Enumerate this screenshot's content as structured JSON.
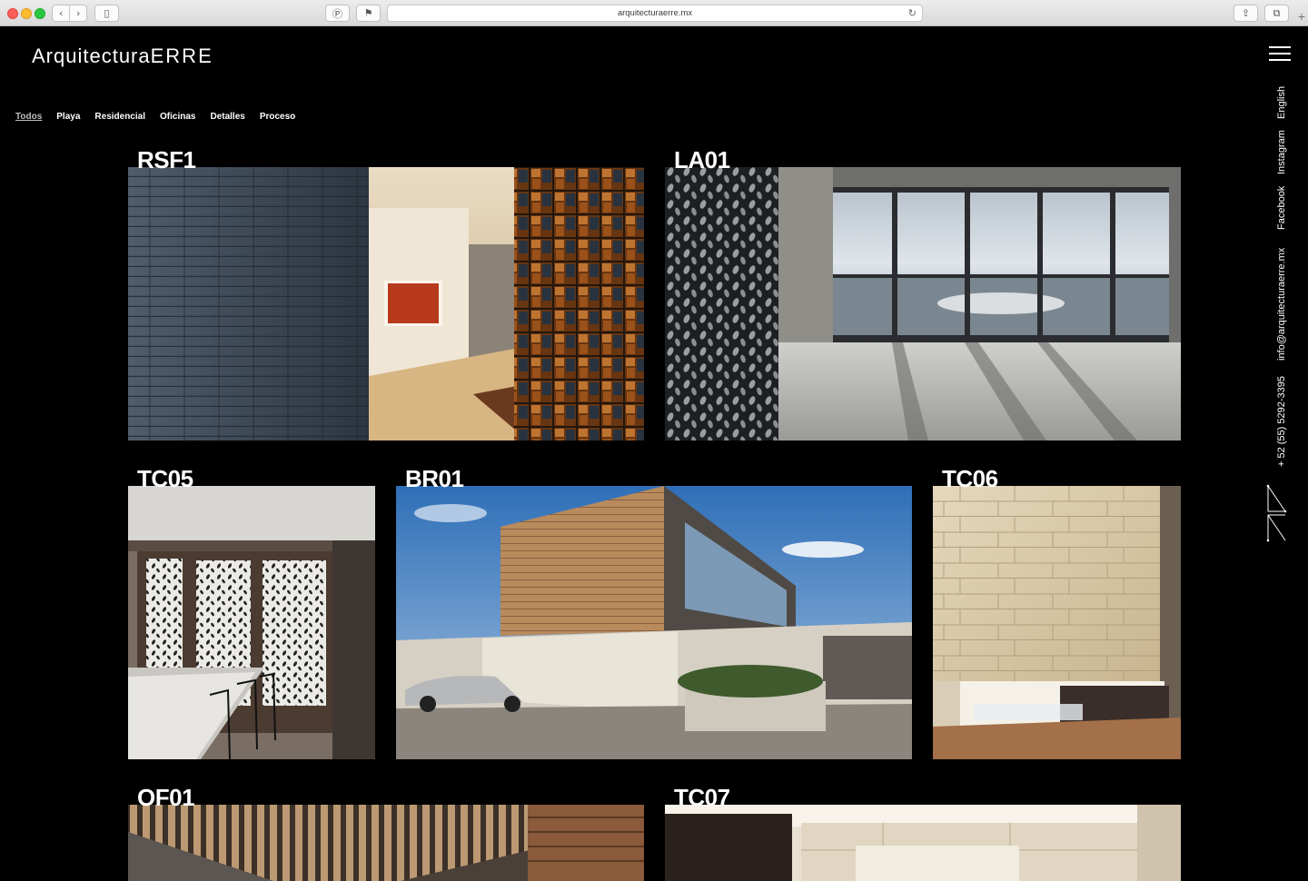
{
  "browser": {
    "url": "arquitecturaerre.mx"
  },
  "site": {
    "logo_light": "Arquitectura",
    "logo_bold": "ERRE"
  },
  "filters": [
    "Todos",
    "Playa",
    "Residencial",
    "Oficinas",
    "Detalles",
    "Proceso"
  ],
  "side_links": {
    "english": "English",
    "instagram": "Instagram",
    "facebook": "Facebook",
    "email": "info@arquitecturaerre.mx",
    "phone": "+ 52 (55) 5292-3395"
  },
  "projects": [
    {
      "code": "RSF1"
    },
    {
      "code": "LA01"
    },
    {
      "code": "TC05"
    },
    {
      "code": "BR01"
    },
    {
      "code": "TC06"
    },
    {
      "code": "OF01"
    },
    {
      "code": "TC07"
    }
  ],
  "colors": {
    "background": "#000000",
    "text": "#ffffff",
    "active_filter": "#bdbdbd"
  }
}
